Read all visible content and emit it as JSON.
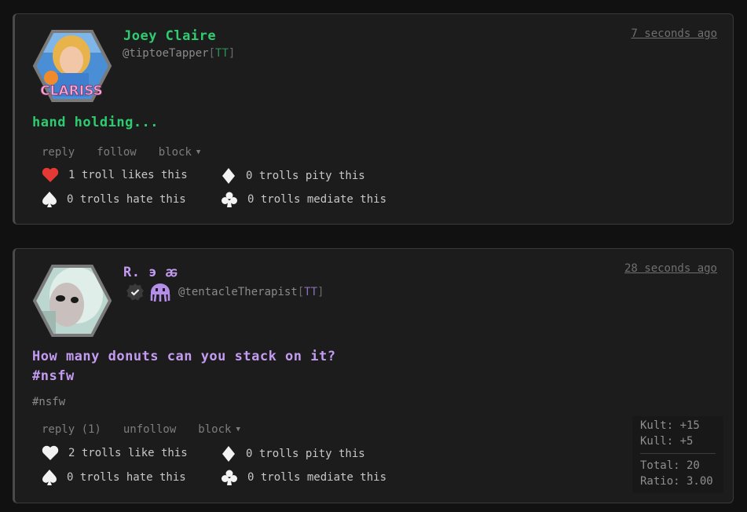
{
  "posts": [
    {
      "name": "Joey Claire",
      "handle": "@tiptoeTapper",
      "tag": "TT",
      "time": "7 seconds ago",
      "body": "hand holding...",
      "avatar_caption": "CLARISS",
      "actions": {
        "reply": "reply",
        "follow": "follow",
        "block": "block"
      },
      "reactions": {
        "like": "1 troll likes this",
        "pity": "0 trolls pity this",
        "hate": "0 trolls hate this",
        "mediate": "0 trolls mediate this"
      }
    },
    {
      "name": "R. ϶ ꬱ",
      "handle": "@tentacleTherapist",
      "tag": "TT",
      "time": "28 seconds ago",
      "body_line1": "How many donuts can you stack on it?",
      "body_line2": "#nsfw",
      "tagline": "#nsfw",
      "actions": {
        "reply": "reply (1)",
        "follow": "unfollow",
        "block": "block"
      },
      "reactions": {
        "like": "2 trolls like this",
        "pity": "0 trolls pity this",
        "hate": "0 trolls hate this",
        "mediate": "0 trolls mediate this"
      },
      "score": {
        "kult": "Kult: +15",
        "kull": "Kull: +5",
        "total": "Total: 20",
        "ratio": "Ratio: 3.00"
      }
    }
  ],
  "colors": {
    "name1": "#2ecc71",
    "name2": "#c39bf0",
    "heart_active": "#e53935"
  },
  "icons": [
    "heart-icon",
    "diamond-icon",
    "spade-icon",
    "club-icon",
    "verified-icon",
    "squid-icon"
  ]
}
